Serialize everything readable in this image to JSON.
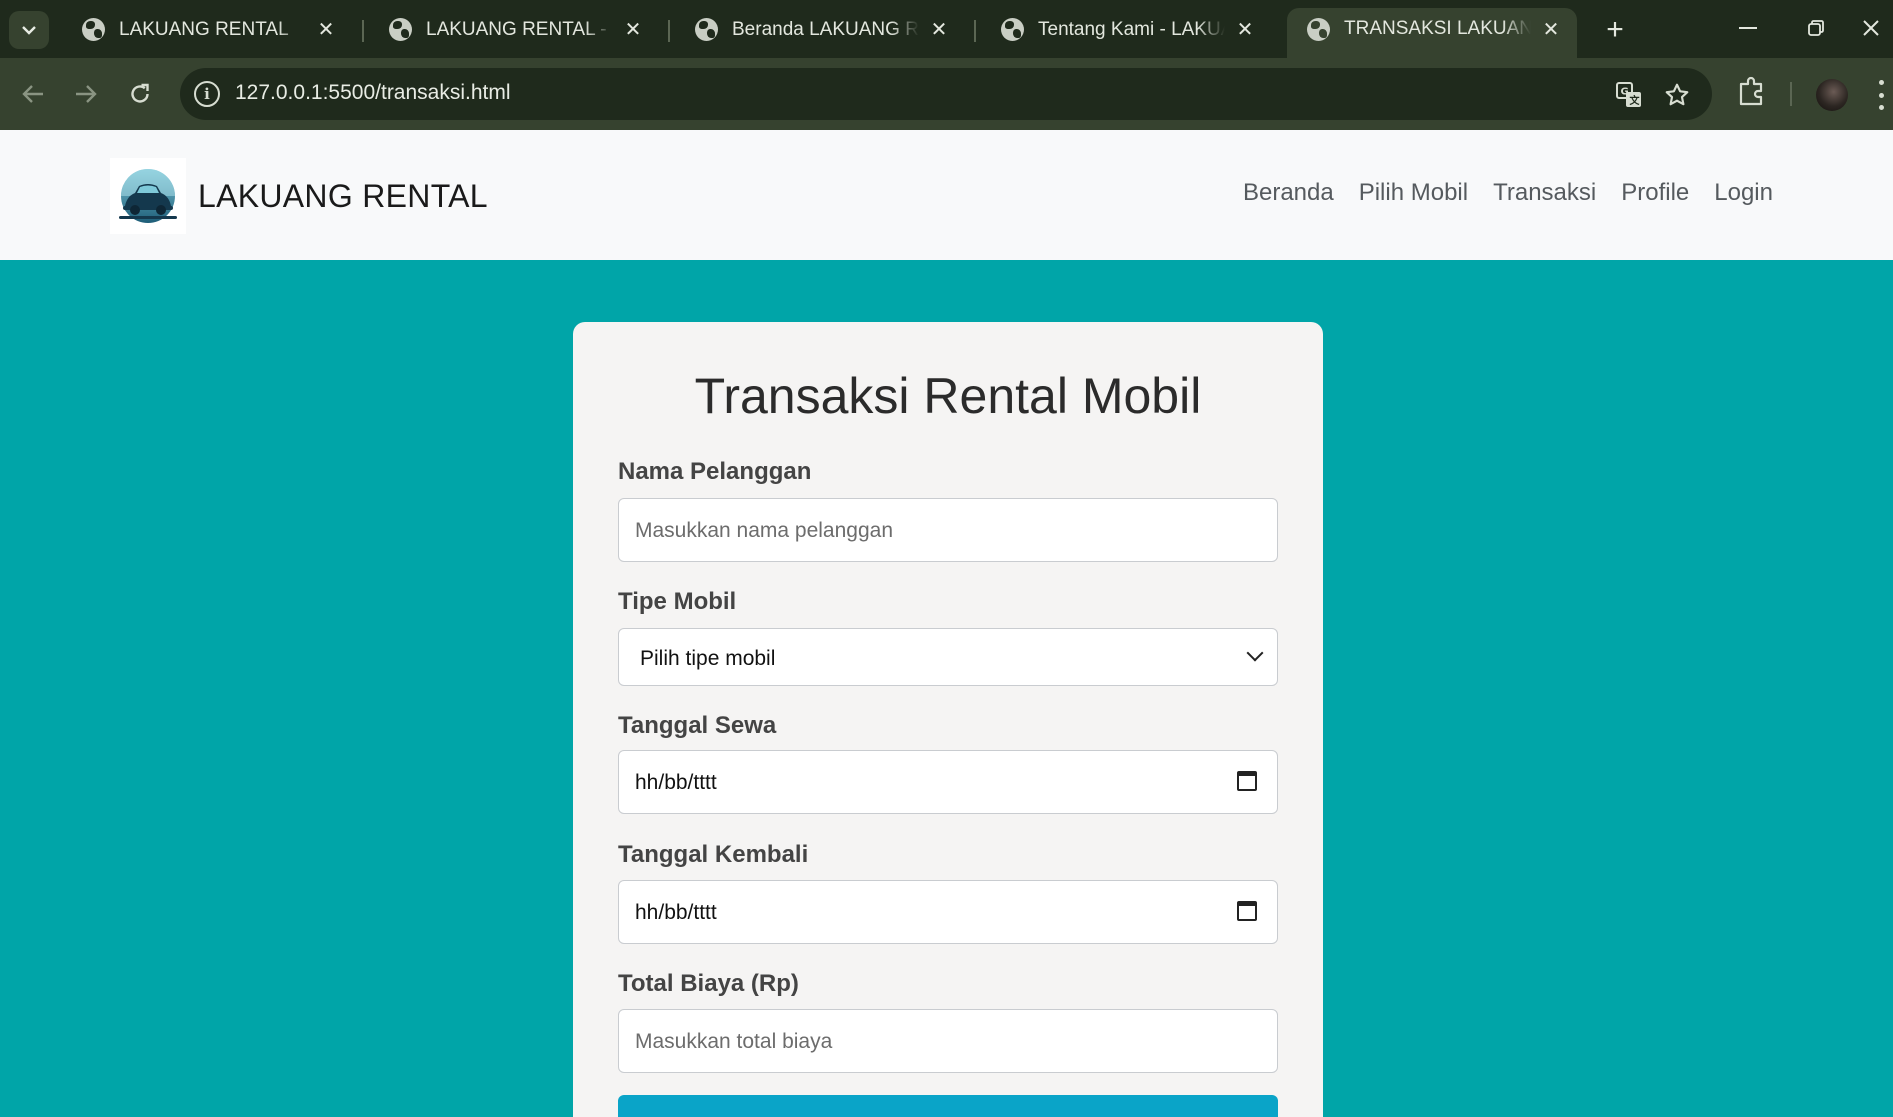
{
  "browser": {
    "tabs": [
      {
        "title": "LAKUANG RENTAL",
        "active": false
      },
      {
        "title": "LAKUANG RENTAL - Login",
        "active": false
      },
      {
        "title": "Beranda LAKUANG RENTAL",
        "active": false
      },
      {
        "title": "Tentang Kami - LAKUANG RENTAL",
        "active": false
      },
      {
        "title": "TRANSAKSI LAKUANG RENTAL",
        "active": true
      }
    ],
    "close_glyph": "✕",
    "new_tab_glyph": "+",
    "url_host": "127.0.0.1",
    "url_path": ":5500/transaksi.html"
  },
  "site": {
    "brand": "LAKUANG RENTAL",
    "menu": [
      "Beranda",
      "Pilih Mobil",
      "Transaksi",
      "Profile",
      "Login"
    ]
  },
  "form": {
    "title": "Transaksi Rental Mobil",
    "nama_label": "Nama Pelanggan",
    "nama_placeholder": "Masukkan nama pelanggan",
    "tipe_label": "Tipe Mobil",
    "tipe_selected": "Pilih tipe mobil",
    "sewa_label": "Tanggal Sewa",
    "sewa_value": "hh/bb/tttt",
    "kembali_label": "Tanggal Kembali",
    "kembali_value": "hh/bb/tttt",
    "biaya_label": "Total Biaya (Rp)",
    "biaya_placeholder": "Masukkan total biaya"
  },
  "colors": {
    "page_bg": "#00a5a8",
    "card_bg": "#f5f4f3",
    "button_bg": "#0aa4c8",
    "navbar_bg": "#f8f9fa"
  }
}
